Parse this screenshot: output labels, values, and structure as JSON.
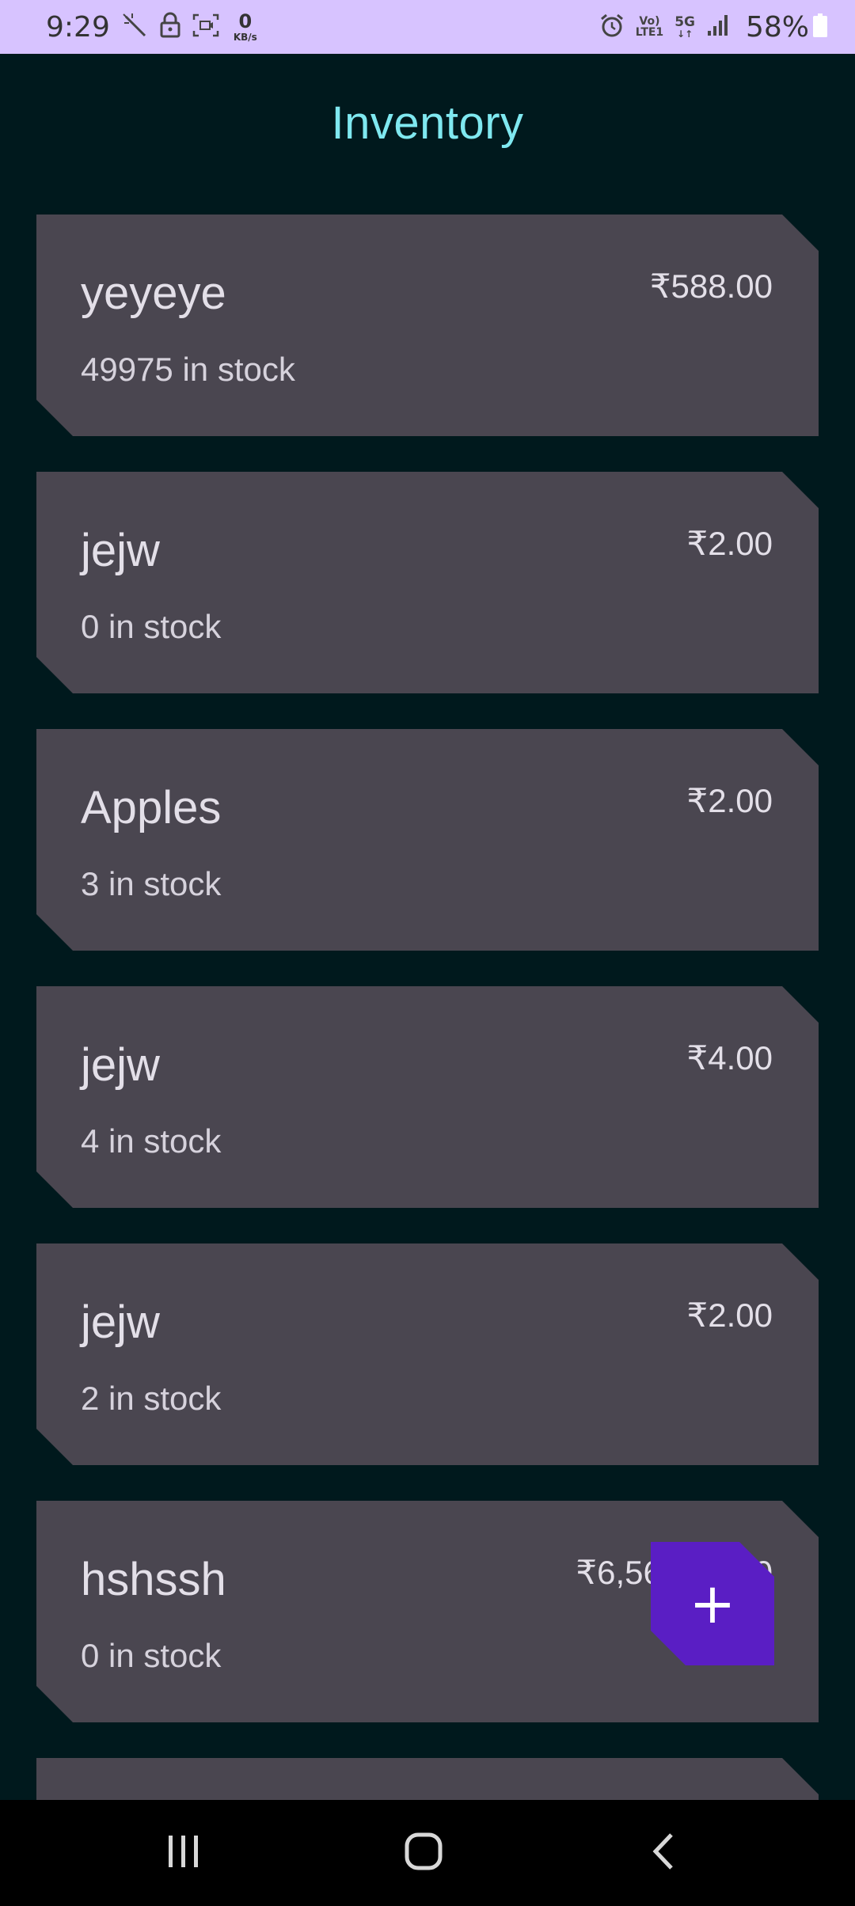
{
  "status_bar": {
    "time": "9:29",
    "net_speed_value": "0",
    "net_speed_unit": "KB/s",
    "volte_top": "Vo)",
    "volte_bottom": "LTE1",
    "network": "5G",
    "network_arrows": "↓↑",
    "battery": "58%",
    "icons": [
      "magic-wand-icon",
      "lock-icon",
      "screenshot-icon",
      "alarm-icon",
      "signal-icon",
      "battery-icon"
    ]
  },
  "header": {
    "title": "Inventory"
  },
  "items": [
    {
      "name": "yeyeye",
      "stock": "49975 in stock",
      "price": "₹588.00"
    },
    {
      "name": "jejw",
      "stock": "0 in stock",
      "price": "₹2.00"
    },
    {
      "name": "Apples",
      "stock": "3 in stock",
      "price": "₹2.00"
    },
    {
      "name": "jejw",
      "stock": "4 in stock",
      "price": "₹4.00"
    },
    {
      "name": "jejw",
      "stock": "2 in stock",
      "price": "₹2.00"
    },
    {
      "name": "hshssh",
      "stock": "0 in stock",
      "price": "₹6,56,568.00"
    },
    {
      "name": "",
      "stock": "",
      "price": ""
    }
  ],
  "fab": {
    "label": "+",
    "icon": "add-icon"
  },
  "nav": {
    "icons": [
      "recent-apps-icon",
      "home-icon",
      "back-icon"
    ]
  },
  "colors": {
    "status_bar_bg": "#d7c3ff",
    "app_bg": "#00191d",
    "title": "#7fe8f0",
    "card_bg": "#4a4650",
    "fab_bg": "#5a1ec4",
    "nav_bg": "#000000"
  }
}
